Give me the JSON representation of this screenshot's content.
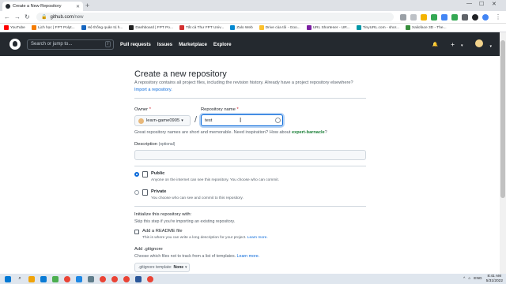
{
  "browser": {
    "tab_title": "Create a New Repository",
    "url_host": "github.com",
    "url_path": "/new",
    "bookmarks": [
      {
        "label": "YouTube",
        "color": "#ff0000"
      },
      {
        "label": "Lịch học | FPT Polyt...",
        "color": "#f57c00"
      },
      {
        "label": "Hệ thống quản trị h...",
        "color": "#1565c0"
      },
      {
        "label": "Dashboard | FPT Po...",
        "color": "#212121"
      },
      {
        "label": "Tất cả Thư FPT Univ...",
        "color": "#d32f2f"
      },
      {
        "label": "Zalo Web",
        "color": "#0288d1"
      },
      {
        "label": "Drive của tôi - Goo...",
        "color": "#fbc02d"
      },
      {
        "label": "URL Shortener - UR...",
        "color": "#7b1fa2"
      },
      {
        "label": "TinyURL.com - shor...",
        "color": "#0097a7"
      },
      {
        "label": "Xalioface 3D - The...",
        "color": "#388e3c"
      }
    ]
  },
  "header": {
    "search_placeholder": "Search or jump to...",
    "search_key": "/",
    "nav": [
      "Pull requests",
      "Issues",
      "Marketplace",
      "Explore"
    ],
    "bell_icon": "🔔",
    "plus_icon": "+",
    "caret": "▾"
  },
  "page": {
    "title": "Create a new repository",
    "subtitle": "A repository contains all project files, including the revision history. Already have a project repository elsewhere?",
    "import_link": "Import a repository.",
    "owner_label": "Owner",
    "owner_value": "learn-game0905",
    "separator": "/",
    "repo_label": "Repository name",
    "required_mark": "*",
    "repo_value": "test",
    "hint_text": "Great repository names are short and memorable. Need inspiration? How about",
    "hint_suggestion": "expert-barnacle",
    "hint_end": "?",
    "description_label": "Description",
    "description_optional": "(optional)",
    "description_value": ""
  },
  "visibility": {
    "public_title": "Public",
    "public_desc": "Anyone on the internet can see this repository. You choose who can commit.",
    "private_title": "Private",
    "private_desc": "You choose who can see and commit to this repository."
  },
  "init": {
    "title": "Initialize this repository with:",
    "subtitle": "Skip this step if you're importing an existing repository.",
    "readme_label": "Add a README file",
    "readme_desc": "This is where you can write a long description for your project.",
    "learn_more": "Learn more.",
    "gitignore_title": "Add .gitignore",
    "gitignore_desc": "Choose which files not to track from a list of templates.",
    "gitignore_button_prefix": ".gitignore template:",
    "gitignore_button_value": "None",
    "caret": "▾"
  },
  "taskbar": {
    "lang": "ENG",
    "time": "8:41 AM",
    "date": "5/31/2022"
  }
}
